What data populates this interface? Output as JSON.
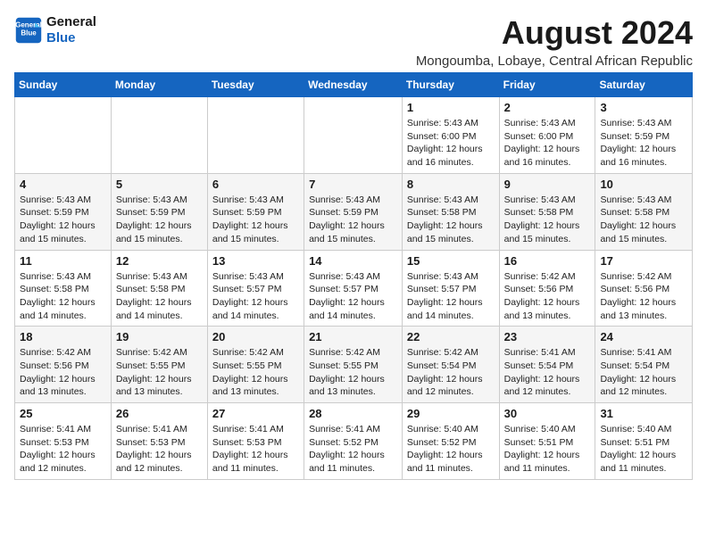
{
  "logo": {
    "line1": "General",
    "line2": "Blue"
  },
  "title": "August 2024",
  "subtitle": "Mongoumba, Lobaye, Central African Republic",
  "days_header": [
    "Sunday",
    "Monday",
    "Tuesday",
    "Wednesday",
    "Thursday",
    "Friday",
    "Saturday"
  ],
  "weeks": [
    [
      {
        "day": "",
        "info": ""
      },
      {
        "day": "",
        "info": ""
      },
      {
        "day": "",
        "info": ""
      },
      {
        "day": "",
        "info": ""
      },
      {
        "day": "1",
        "info": "Sunrise: 5:43 AM\nSunset: 6:00 PM\nDaylight: 12 hours\nand 16 minutes."
      },
      {
        "day": "2",
        "info": "Sunrise: 5:43 AM\nSunset: 6:00 PM\nDaylight: 12 hours\nand 16 minutes."
      },
      {
        "day": "3",
        "info": "Sunrise: 5:43 AM\nSunset: 5:59 PM\nDaylight: 12 hours\nand 16 minutes."
      }
    ],
    [
      {
        "day": "4",
        "info": "Sunrise: 5:43 AM\nSunset: 5:59 PM\nDaylight: 12 hours\nand 15 minutes."
      },
      {
        "day": "5",
        "info": "Sunrise: 5:43 AM\nSunset: 5:59 PM\nDaylight: 12 hours\nand 15 minutes."
      },
      {
        "day": "6",
        "info": "Sunrise: 5:43 AM\nSunset: 5:59 PM\nDaylight: 12 hours\nand 15 minutes."
      },
      {
        "day": "7",
        "info": "Sunrise: 5:43 AM\nSunset: 5:59 PM\nDaylight: 12 hours\nand 15 minutes."
      },
      {
        "day": "8",
        "info": "Sunrise: 5:43 AM\nSunset: 5:58 PM\nDaylight: 12 hours\nand 15 minutes."
      },
      {
        "day": "9",
        "info": "Sunrise: 5:43 AM\nSunset: 5:58 PM\nDaylight: 12 hours\nand 15 minutes."
      },
      {
        "day": "10",
        "info": "Sunrise: 5:43 AM\nSunset: 5:58 PM\nDaylight: 12 hours\nand 15 minutes."
      }
    ],
    [
      {
        "day": "11",
        "info": "Sunrise: 5:43 AM\nSunset: 5:58 PM\nDaylight: 12 hours\nand 14 minutes."
      },
      {
        "day": "12",
        "info": "Sunrise: 5:43 AM\nSunset: 5:58 PM\nDaylight: 12 hours\nand 14 minutes."
      },
      {
        "day": "13",
        "info": "Sunrise: 5:43 AM\nSunset: 5:57 PM\nDaylight: 12 hours\nand 14 minutes."
      },
      {
        "day": "14",
        "info": "Sunrise: 5:43 AM\nSunset: 5:57 PM\nDaylight: 12 hours\nand 14 minutes."
      },
      {
        "day": "15",
        "info": "Sunrise: 5:43 AM\nSunset: 5:57 PM\nDaylight: 12 hours\nand 14 minutes."
      },
      {
        "day": "16",
        "info": "Sunrise: 5:42 AM\nSunset: 5:56 PM\nDaylight: 12 hours\nand 13 minutes."
      },
      {
        "day": "17",
        "info": "Sunrise: 5:42 AM\nSunset: 5:56 PM\nDaylight: 12 hours\nand 13 minutes."
      }
    ],
    [
      {
        "day": "18",
        "info": "Sunrise: 5:42 AM\nSunset: 5:56 PM\nDaylight: 12 hours\nand 13 minutes."
      },
      {
        "day": "19",
        "info": "Sunrise: 5:42 AM\nSunset: 5:55 PM\nDaylight: 12 hours\nand 13 minutes."
      },
      {
        "day": "20",
        "info": "Sunrise: 5:42 AM\nSunset: 5:55 PM\nDaylight: 12 hours\nand 13 minutes."
      },
      {
        "day": "21",
        "info": "Sunrise: 5:42 AM\nSunset: 5:55 PM\nDaylight: 12 hours\nand 13 minutes."
      },
      {
        "day": "22",
        "info": "Sunrise: 5:42 AM\nSunset: 5:54 PM\nDaylight: 12 hours\nand 12 minutes."
      },
      {
        "day": "23",
        "info": "Sunrise: 5:41 AM\nSunset: 5:54 PM\nDaylight: 12 hours\nand 12 minutes."
      },
      {
        "day": "24",
        "info": "Sunrise: 5:41 AM\nSunset: 5:54 PM\nDaylight: 12 hours\nand 12 minutes."
      }
    ],
    [
      {
        "day": "25",
        "info": "Sunrise: 5:41 AM\nSunset: 5:53 PM\nDaylight: 12 hours\nand 12 minutes."
      },
      {
        "day": "26",
        "info": "Sunrise: 5:41 AM\nSunset: 5:53 PM\nDaylight: 12 hours\nand 12 minutes."
      },
      {
        "day": "27",
        "info": "Sunrise: 5:41 AM\nSunset: 5:53 PM\nDaylight: 12 hours\nand 11 minutes."
      },
      {
        "day": "28",
        "info": "Sunrise: 5:41 AM\nSunset: 5:52 PM\nDaylight: 12 hours\nand 11 minutes."
      },
      {
        "day": "29",
        "info": "Sunrise: 5:40 AM\nSunset: 5:52 PM\nDaylight: 12 hours\nand 11 minutes."
      },
      {
        "day": "30",
        "info": "Sunrise: 5:40 AM\nSunset: 5:51 PM\nDaylight: 12 hours\nand 11 minutes."
      },
      {
        "day": "31",
        "info": "Sunrise: 5:40 AM\nSunset: 5:51 PM\nDaylight: 12 hours\nand 11 minutes."
      }
    ]
  ]
}
